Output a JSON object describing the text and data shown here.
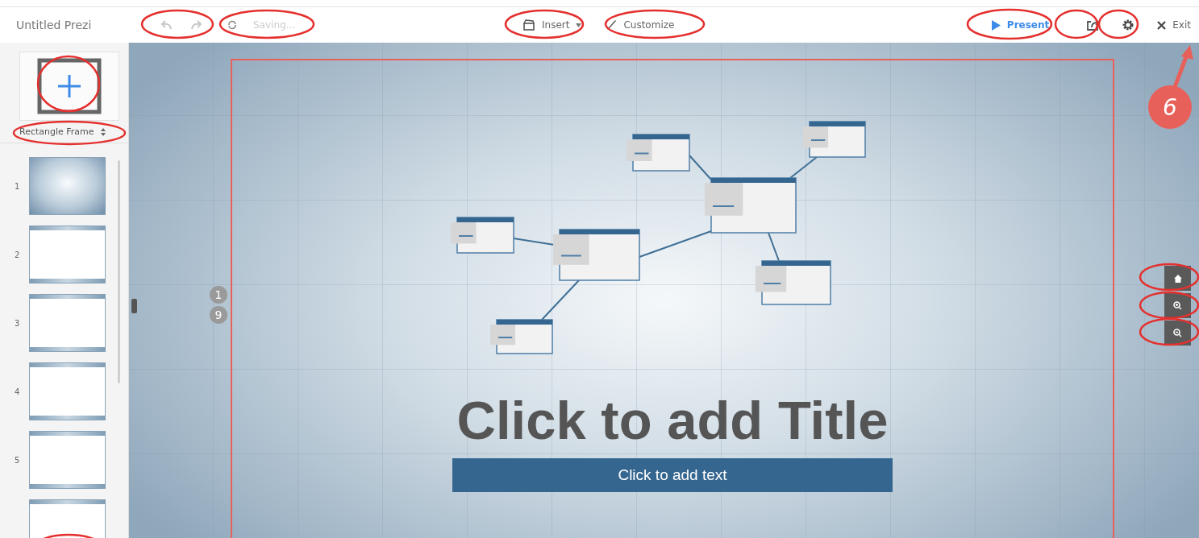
{
  "document_title": "Untitled Prezi",
  "save_status": "Saving...",
  "toolbar": [
    {
      "kind": "insert",
      "label": "Insert"
    },
    {
      "kind": "customize",
      "label": "Customize"
    }
  ],
  "present": {
    "label": "Present"
  },
  "exit": {
    "label": "Exit"
  },
  "frame_picker": {
    "label": "Rectangle Frame"
  },
  "thumbnails": [
    {
      "number": "1",
      "kind": "title"
    },
    {
      "number": "2",
      "kind": "frame"
    },
    {
      "number": "3",
      "kind": "frame"
    },
    {
      "number": "4",
      "kind": "frame"
    },
    {
      "number": "5",
      "kind": "frame"
    },
    {
      "kind": "frame"
    }
  ],
  "path_steps": [
    "1",
    "9"
  ],
  "slide": {
    "title": "Click to add Title",
    "subtitle": "Click to add text"
  },
  "callout": {
    "label": "6"
  }
}
